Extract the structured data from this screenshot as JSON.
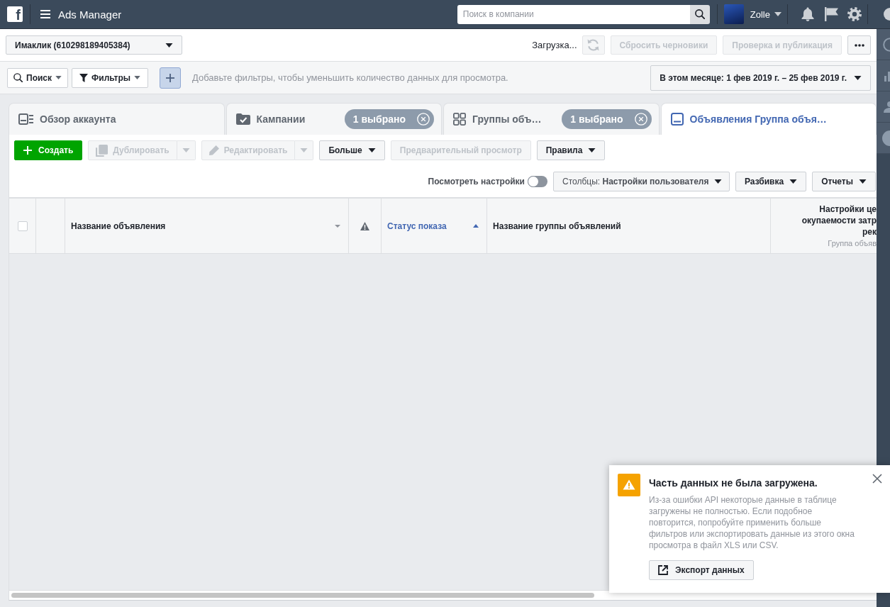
{
  "top_bar": {
    "logo": "f",
    "title": "Ads Manager",
    "search": {
      "placeholder": "Поиск в компании"
    },
    "account": "Zolle"
  },
  "account_bar": {
    "account_selector": "Имаклик (610298189405384)",
    "status": "Загрузка...",
    "actions": [
      {
        "kind": "refresh",
        "disabled": true
      },
      {
        "kind": "text",
        "label": "Сбросить черновики",
        "disabled": true
      },
      {
        "kind": "text",
        "label": "Проверка и публикация",
        "disabled": true
      },
      {
        "kind": "more",
        "disabled": false
      }
    ]
  },
  "filter_bar": {
    "search_button": "Поиск",
    "filters_button": "Фильтры",
    "hint": "Добавьте фильтры, чтобы уменьшить количество данных для просмотра.",
    "date_range": "В этом месяце: 1 фев 2019 г. – 25 фев 2019 г."
  },
  "tabs": [
    {
      "kind": "overview",
      "label": "Обзор аккаунта",
      "selected": false
    },
    {
      "kind": "campaigns",
      "label": "Кампании",
      "badge": "1 выбрано",
      "selected": false
    },
    {
      "kind": "ad_sets",
      "label": "Группы объ…",
      "badge": "1 выбрано",
      "selected": false
    },
    {
      "kind": "ads",
      "label": "Объявления Группа объя…",
      "selected": true
    }
  ],
  "toolbar": [
    {
      "kind": "create",
      "label": "Создать",
      "disabled": false
    },
    {
      "kind": "duplicate",
      "label": "Дублировать",
      "disabled": true
    },
    {
      "kind": "edit",
      "label": "Редактировать",
      "disabled": true
    },
    {
      "kind": "menu",
      "label": "Больше",
      "disabled": false
    },
    {
      "kind": "plain",
      "label": "Предварительный просмотр",
      "disabled": true
    },
    {
      "kind": "menu",
      "label": "Правила",
      "disabled": false
    }
  ],
  "view_bar": {
    "settings_toggle": {
      "label": "Посмотреть настройки",
      "on": false
    },
    "columns_button": "Столбцы: **Настройки пользователя**",
    "breakdown_button": "Разбивка",
    "reports_button": "Отчеты"
  },
  "table": {
    "columns": [
      {
        "kind": "checkbox",
        "checked": false
      },
      {
        "kind": "blank"
      },
      {
        "kind": "text",
        "label": "Название объявления",
        "sorted": false,
        "menu": true
      },
      {
        "kind": "warning"
      },
      {
        "kind": "text",
        "label": "Статус показа",
        "sorted": true,
        "menu": false
      },
      {
        "kind": "text",
        "label": "Название группы объявлений",
        "sorted": false,
        "menu": false
      },
      {
        "kind": "stacked",
        "lines": [
          "Настройки це",
          "окупаемости затр",
          "рек"
        ],
        "subtitle": "Группа объяв"
      }
    ]
  },
  "notification": {
    "title": "Часть данных не была загружена.",
    "message": "Из-за ошибки API некоторые данные в таблице загружены не полностью. Если подобное повторится, попробуйте применить больше фильтров или экспортировать данные из этого окна просмотра в файл XLS или CSV.",
    "button": "Экспорт данных"
  }
}
